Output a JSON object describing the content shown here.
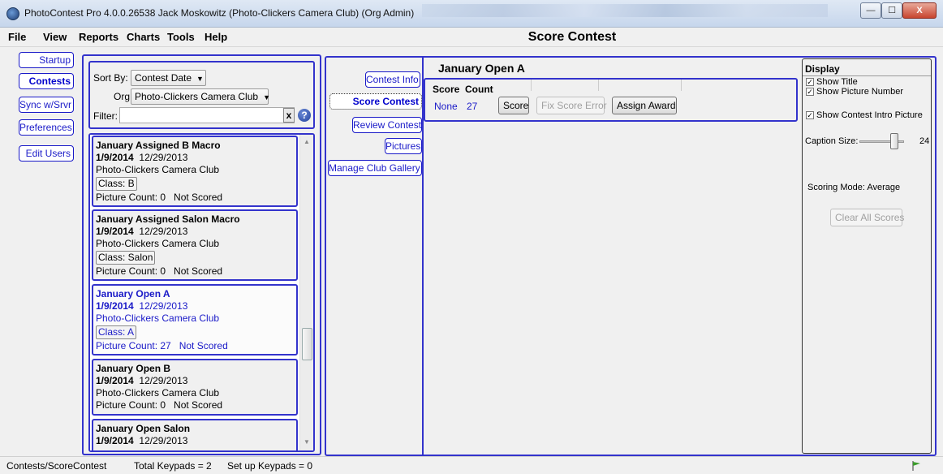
{
  "window": {
    "title": "PhotoContest Pro 4.0.0.26538 Jack Moskowitz (Photo-Clickers Camera Club) (Org Admin)",
    "buttons": {
      "minimize": "—",
      "maximize": "☐",
      "close": "X"
    }
  },
  "menu": {
    "items": [
      "File",
      "View",
      "Reports",
      "Charts",
      "Tools",
      "Help"
    ],
    "screen_title": "Score Contest"
  },
  "sidebar": {
    "items": [
      {
        "label": "Startup",
        "active": false
      },
      {
        "label": "Contests",
        "active": true
      },
      {
        "label": "Sync w/Srvr",
        "active": false
      },
      {
        "label": "Preferences",
        "active": false
      },
      {
        "label": "Edit Users",
        "active": false
      }
    ]
  },
  "contest_list": {
    "sort_label": "Sort By:",
    "sort_value": "Contest Date",
    "org_label": "Org:",
    "org_value": "Photo-Clickers Camera Club",
    "filter_label": "Filter:",
    "filter_value": "",
    "clear_filter": "x",
    "help": "?",
    "contests": [
      {
        "name": "January Assigned B Macro",
        "date1": "1/9/2014",
        "date2": "12/29/2013",
        "org": "Photo-Clickers Camera Club",
        "class": "Class: B",
        "count": "Picture Count: 0",
        "status": "Not Scored"
      },
      {
        "name": "January Assigned Salon Macro",
        "date1": "1/9/2014",
        "date2": "12/29/2013",
        "org": "Photo-Clickers Camera Club",
        "class": "Class: Salon",
        "count": "Picture Count: 0",
        "status": "Not Scored"
      },
      {
        "name": "January Open A",
        "date1": "1/9/2014",
        "date2": "12/29/2013",
        "org": "Photo-Clickers Camera Club",
        "class": "Class: A",
        "count": "Picture Count: 27",
        "status": "Not Scored"
      },
      {
        "name": "January Open B",
        "date1": "1/9/2014",
        "date2": "12/29/2013",
        "org": "Photo-Clickers Camera Club",
        "class": "",
        "count": "Picture Count: 0",
        "status": "Not Scored"
      },
      {
        "name": "January Open Salon",
        "date1": "1/9/2014",
        "date2": "12/29/2013",
        "org": "",
        "class": "",
        "count": "",
        "status": ""
      }
    ]
  },
  "contest_nav": {
    "tabs": [
      {
        "label": "Contest Info",
        "active": false
      },
      {
        "label": "Score Contest",
        "active": true
      },
      {
        "label": "Review Contest",
        "active": false
      },
      {
        "label": "Pictures",
        "active": false
      },
      {
        "label": "Manage Club Gallery",
        "active": false
      }
    ]
  },
  "score": {
    "contest_title": "January Open A",
    "col_score": "Score",
    "col_count": "Count",
    "row_score": "None",
    "row_count": "27",
    "btn_score": "Score",
    "btn_fix": "Fix Score Error",
    "btn_award": "Assign Award"
  },
  "display": {
    "title": "Display",
    "show_title": "Show Title",
    "show_picture_number": "Show Picture Number",
    "show_intro_picture": "Show Contest Intro Picture",
    "caption_size_label": "Caption Size:",
    "caption_size_value": "24",
    "caption_size_fraction": 0.73,
    "scoring_mode": "Scoring Mode: Average",
    "clear_all": "Clear All Scores",
    "check_mark": "✓"
  },
  "status": {
    "path": "Contests/ScoreContest",
    "keypads": "Total Keypads = 2",
    "setup": "Set up Keypads = 0"
  }
}
